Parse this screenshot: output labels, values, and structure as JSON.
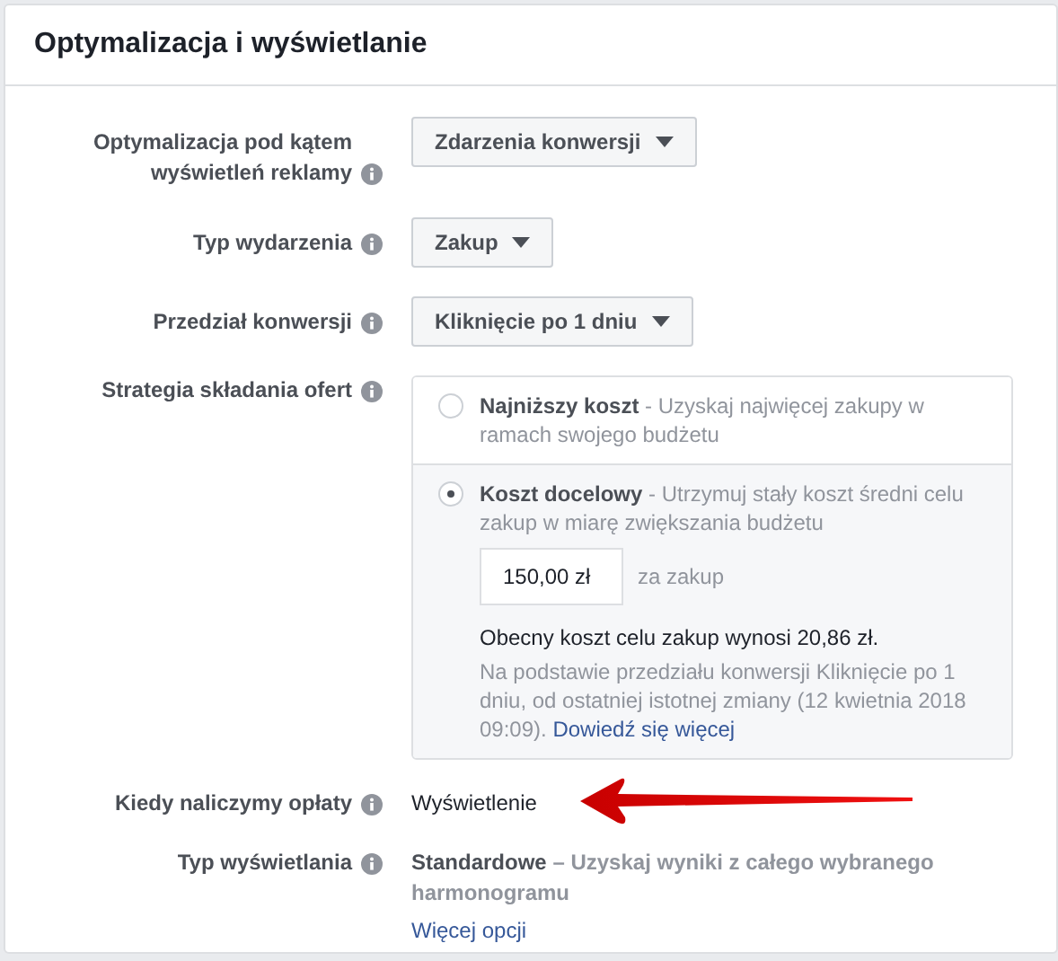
{
  "panel": {
    "title": "Optymalizacja i wyświetlanie"
  },
  "rows": [
    {
      "kind": "dropdown",
      "label": "Optymalizacja pod kątem wyświetleń reklamy",
      "value": "Zdarzenia konwersji"
    },
    {
      "kind": "dropdown",
      "label": "Typ wydarzenia",
      "value": "Zakup"
    },
    {
      "kind": "dropdown",
      "label": "Przedział konwersji",
      "value": "Kliknięcie po 1 dniu"
    },
    {
      "kind": "strategy",
      "label": "Strategia składania ofert",
      "options": [
        {
          "title": "Najniższy koszt",
          "description": " - Uzyskaj najwięcej zakupy w ramach swojego budżetu",
          "selected": false
        },
        {
          "title": "Koszt docelowy",
          "description": " - Utrzymuj stały koszt średni celu zakup w miarę zwiększania budżetu",
          "selected": true,
          "bid": {
            "value": "150,00 zł",
            "unit": "za zakup"
          },
          "current": "Obecny koszt celu zakup wynosi 20,86 zł.",
          "note": "Na podstawie przedziału konwersji Kliknięcie po 1 dniu, od ostatniej istotnej zmiany (12 kwietnia 2018 09:09).",
          "link": "Dowiedź się więcej"
        }
      ]
    },
    {
      "kind": "text",
      "label": "Kiedy naliczymy opłaty",
      "value": "Wyświetlenie"
    },
    {
      "kind": "display",
      "label": "Typ wyświetlania",
      "name": "Standardowe",
      "description": " – Uzyskaj wyniki z całego wybranego harmonogramu",
      "link": "Więcej opcji"
    }
  ]
}
